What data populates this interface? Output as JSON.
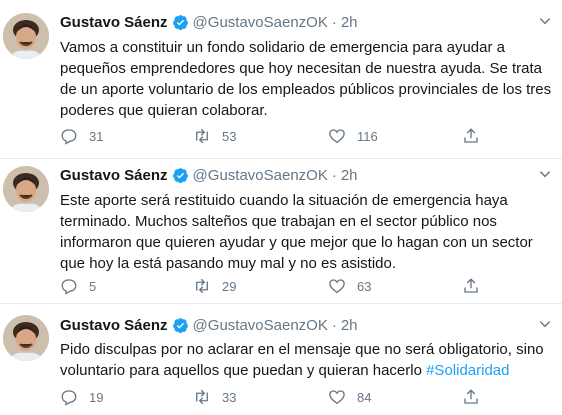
{
  "author": {
    "name": "Gustavo Sáenz",
    "handle": "@GustavoSaenzOK"
  },
  "colors": {
    "verified": "#1da1f2",
    "hashtag": "#1da1f2",
    "muted": "#657786",
    "text": "#14171a"
  },
  "tweets": [
    {
      "time": "2h",
      "text": "Vamos a constituir un fondo solidario de emergencia para ayudar a pequeños emprendedores que hoy necesitan de nuestra ayuda. Se trata de un aporte voluntario de los empleados públicos provinciales de los tres poderes que quieran colaborar.",
      "hashtag": "",
      "replies": "31",
      "retweets": "53",
      "likes": "116"
    },
    {
      "time": "2h",
      "text": "Este aporte será restituido cuando la situación de emergencia haya terminado. Muchos salteños que trabajan en el sector público nos informaron que quieren ayudar y que mejor que lo hagan con un sector que hoy la está pasando muy mal y no es asistido.",
      "hashtag": "",
      "replies": "5",
      "retweets": "29",
      "likes": "63"
    },
    {
      "time": "2h",
      "text": "Pido disculpas por no aclarar en el mensaje que no será obligatorio, sino voluntario para aquellos que puedan y quieran hacerlo ",
      "hashtag": "#Solidaridad",
      "replies": "19",
      "retweets": "33",
      "likes": "84"
    }
  ],
  "icons": {
    "verified": "verified-badge-icon",
    "caret": "chevron-down-icon",
    "reply": "reply-icon",
    "retweet": "retweet-icon",
    "like": "heart-icon",
    "share": "share-icon"
  }
}
